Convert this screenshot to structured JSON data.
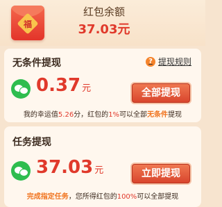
{
  "header": {
    "balance_label": "红包余额",
    "balance_amount": "37.03元",
    "envelope_char": "福"
  },
  "unconditional": {
    "title": "无条件提现",
    "rules_link": "提现规则",
    "rules_icon": "?",
    "amount": "0.37",
    "unit": "元",
    "button": "全部提现",
    "note_1": "我的幸运值",
    "luck_value": "5.26",
    "note_2": "分，红包的",
    "percent": "1%",
    "note_3": "可以全部",
    "note_4": "无条件",
    "note_5": "提现"
  },
  "task": {
    "title": "任务提现",
    "amount": "37.03",
    "unit": "元",
    "button": "立即提现",
    "note_1": "完成指定任务",
    "note_2": "，您所得红包的",
    "percent": "100%",
    "note_3": "可以全部提现"
  },
  "colors": {
    "accent_red": "#e0392b",
    "wechat_green": "#2ebd4f",
    "background": "#f7e4cf"
  }
}
